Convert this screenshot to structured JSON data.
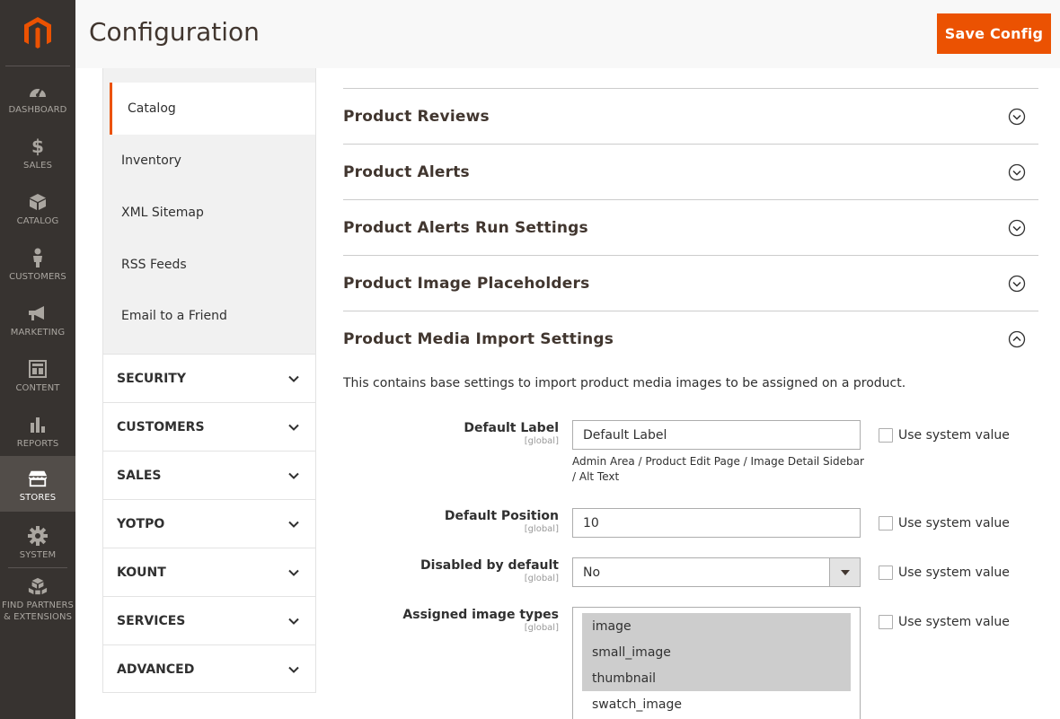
{
  "header": {
    "title": "Configuration",
    "save_label": "Save Config"
  },
  "admin_nav": {
    "items": [
      {
        "label": "DASHBOARD",
        "icon": "dashboard-icon"
      },
      {
        "label": "SALES",
        "icon": "dollar-icon"
      },
      {
        "label": "CATALOG",
        "icon": "cube-icon"
      },
      {
        "label": "CUSTOMERS",
        "icon": "person-icon"
      },
      {
        "label": "MARKETING",
        "icon": "megaphone-icon"
      },
      {
        "label": "CONTENT",
        "icon": "layout-icon"
      },
      {
        "label": "REPORTS",
        "icon": "bar-chart-icon"
      },
      {
        "label": "STORES",
        "icon": "storefront-icon"
      },
      {
        "label": "SYSTEM",
        "icon": "gear-icon"
      },
      {
        "label": "FIND PARTNERS\n& EXTENSIONS",
        "icon": "boxes-icon"
      }
    ],
    "active": "STORES"
  },
  "config_sidebar": {
    "sub_items": [
      "Catalog",
      "Inventory",
      "XML Sitemap",
      "RSS Feeds",
      "Email to a Friend"
    ],
    "active_sub_item": "Catalog",
    "sections": [
      "SECURITY",
      "CUSTOMERS",
      "SALES",
      "YOTPO",
      "KOUNT",
      "SERVICES",
      "ADVANCED"
    ]
  },
  "groups": [
    {
      "title": "Product Reviews",
      "expanded": false
    },
    {
      "title": "Product Alerts",
      "expanded": false
    },
    {
      "title": "Product Alerts Run Settings",
      "expanded": false
    },
    {
      "title": "Product Image Placeholders",
      "expanded": false
    },
    {
      "title": "Product Media Import Settings",
      "expanded": true
    }
  ],
  "media_import": {
    "description": "This contains base settings to import product media images to be assigned on a product.",
    "fields": [
      {
        "label": "Default Label",
        "scope": "[global]",
        "value": "Default Label",
        "note": "Admin Area / Product Edit Page / Image Detail Sidebar / Alt Text",
        "use_system_value": "Use system value"
      },
      {
        "label": "Default Position",
        "scope": "[global]",
        "value": "10",
        "use_system_value": "Use system value"
      },
      {
        "label": "Disabled by default",
        "scope": "[global]",
        "value": "No",
        "use_system_value": "Use system value"
      },
      {
        "label": "Assigned image types",
        "scope": "[global]",
        "options": [
          "image",
          "small_image",
          "thumbnail",
          "swatch_image"
        ],
        "selected": [
          "image",
          "small_image",
          "thumbnail"
        ],
        "use_system_value": "Use system value"
      }
    ]
  },
  "colors": {
    "accent": "#eb5202",
    "nav_bg": "#373330",
    "nav_active": "#524d49"
  }
}
